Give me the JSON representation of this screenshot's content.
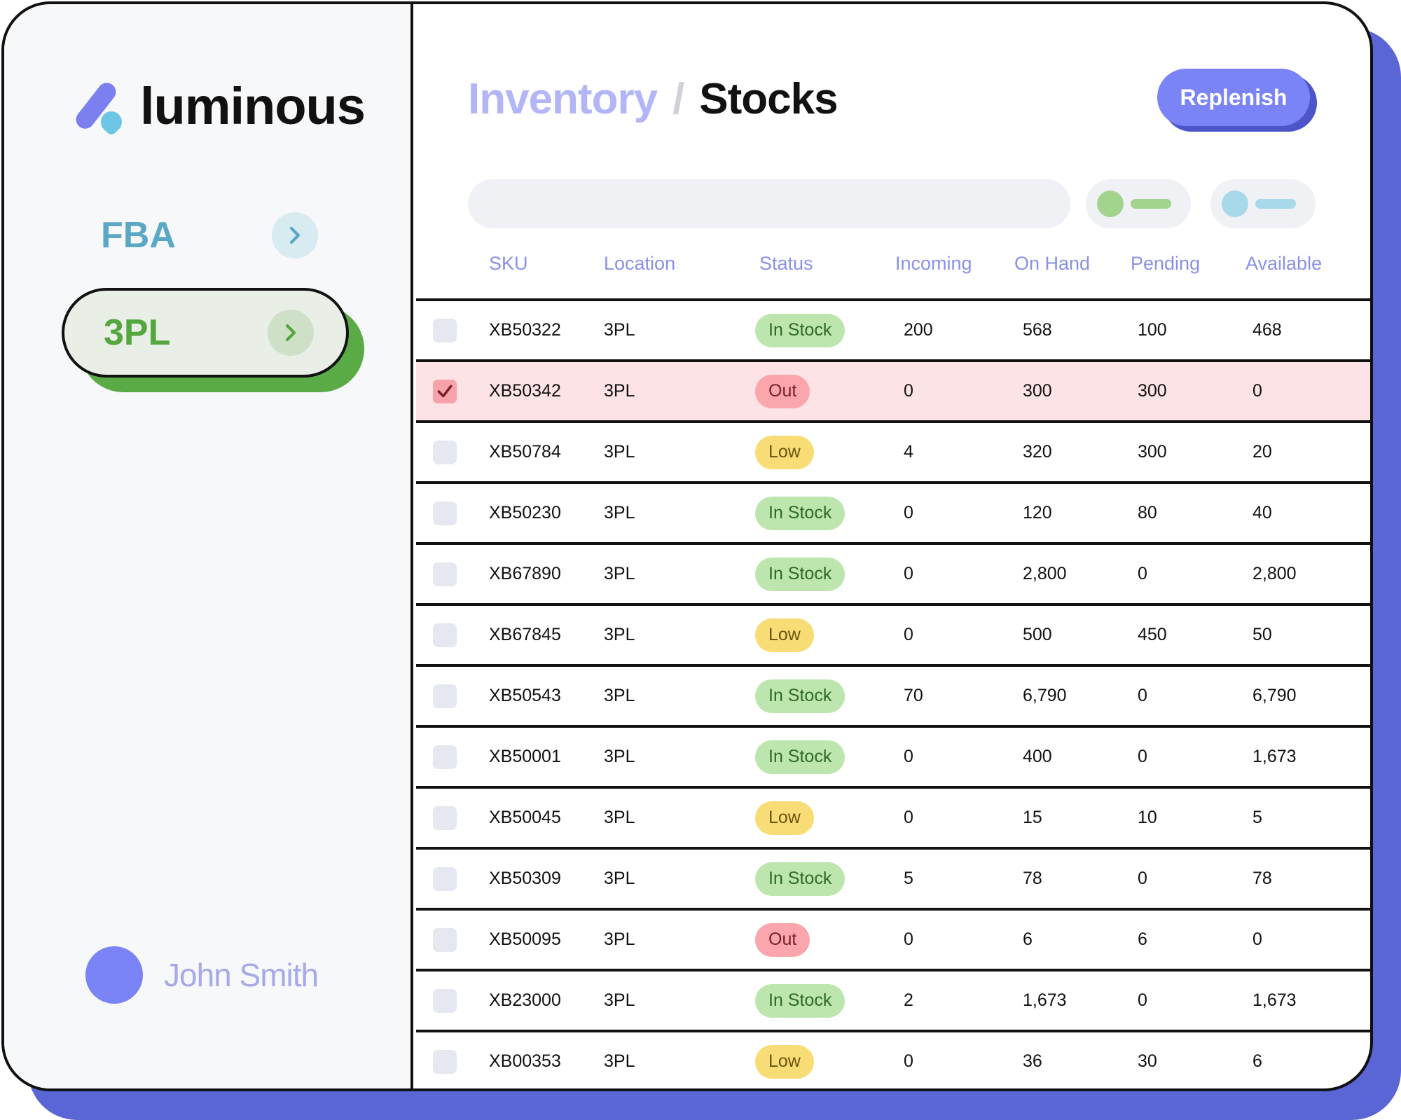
{
  "brand": {
    "name": "luminous"
  },
  "sidebar": {
    "items": [
      {
        "label": "FBA",
        "active": false
      },
      {
        "label": "3PL",
        "active": true
      }
    ],
    "user": {
      "name": "John Smith"
    }
  },
  "header": {
    "breadcrumb_parent": "Inventory",
    "breadcrumb_separator": "/",
    "breadcrumb_current": "Stocks",
    "replenish_label": "Replenish"
  },
  "colors": {
    "accent": "#7b84f7",
    "accent_shadow": "#4c55c9",
    "in_stock": "#bde5ae",
    "out": "#fba5ad",
    "low": "#f8dd76",
    "selected_row": "#fde3e6"
  },
  "table": {
    "columns": [
      "SKU",
      "Location",
      "Status",
      "Incoming",
      "On Hand",
      "Pending",
      "Available"
    ],
    "rows": [
      {
        "checked": false,
        "sku": "XB50322",
        "location": "3PL",
        "status": "In Stock",
        "status_type": "instock",
        "incoming": "200",
        "on_hand": "568",
        "pending": "100",
        "available": "468"
      },
      {
        "checked": true,
        "sku": "XB50342",
        "location": "3PL",
        "status": "Out",
        "status_type": "out",
        "incoming": "0",
        "on_hand": "300",
        "pending": "300",
        "available": "0"
      },
      {
        "checked": false,
        "sku": "XB50784",
        "location": "3PL",
        "status": "Low",
        "status_type": "low",
        "incoming": "4",
        "on_hand": "320",
        "pending": "300",
        "available": "20"
      },
      {
        "checked": false,
        "sku": "XB50230",
        "location": "3PL",
        "status": "In Stock",
        "status_type": "instock",
        "incoming": "0",
        "on_hand": "120",
        "pending": "80",
        "available": "40"
      },
      {
        "checked": false,
        "sku": "XB67890",
        "location": "3PL",
        "status": "In Stock",
        "status_type": "instock",
        "incoming": "0",
        "on_hand": "2,800",
        "pending": "0",
        "available": "2,800"
      },
      {
        "checked": false,
        "sku": "XB67845",
        "location": "3PL",
        "status": "Low",
        "status_type": "low",
        "incoming": "0",
        "on_hand": "500",
        "pending": "450",
        "available": "50"
      },
      {
        "checked": false,
        "sku": "XB50543",
        "location": "3PL",
        "status": "In Stock",
        "status_type": "instock",
        "incoming": "70",
        "on_hand": "6,790",
        "pending": "0",
        "available": "6,790"
      },
      {
        "checked": false,
        "sku": "XB50001",
        "location": "3PL",
        "status": "In Stock",
        "status_type": "instock",
        "incoming": "0",
        "on_hand": "400",
        "pending": "0",
        "available": "1,673"
      },
      {
        "checked": false,
        "sku": "XB50045",
        "location": "3PL",
        "status": "Low",
        "status_type": "low",
        "incoming": "0",
        "on_hand": "15",
        "pending": "10",
        "available": "5"
      },
      {
        "checked": false,
        "sku": "XB50309",
        "location": "3PL",
        "status": "In Stock",
        "status_type": "instock",
        "incoming": "5",
        "on_hand": "78",
        "pending": "0",
        "available": "78"
      },
      {
        "checked": false,
        "sku": "XB50095",
        "location": "3PL",
        "status": "Out",
        "status_type": "out",
        "incoming": "0",
        "on_hand": "6",
        "pending": "6",
        "available": "0"
      },
      {
        "checked": false,
        "sku": "XB23000",
        "location": "3PL",
        "status": "In Stock",
        "status_type": "instock",
        "incoming": "2",
        "on_hand": "1,673",
        "pending": "0",
        "available": "1,673"
      },
      {
        "checked": false,
        "sku": "XB00353",
        "location": "3PL",
        "status": "Low",
        "status_type": "low",
        "incoming": "0",
        "on_hand": "36",
        "pending": "30",
        "available": "6"
      }
    ]
  }
}
